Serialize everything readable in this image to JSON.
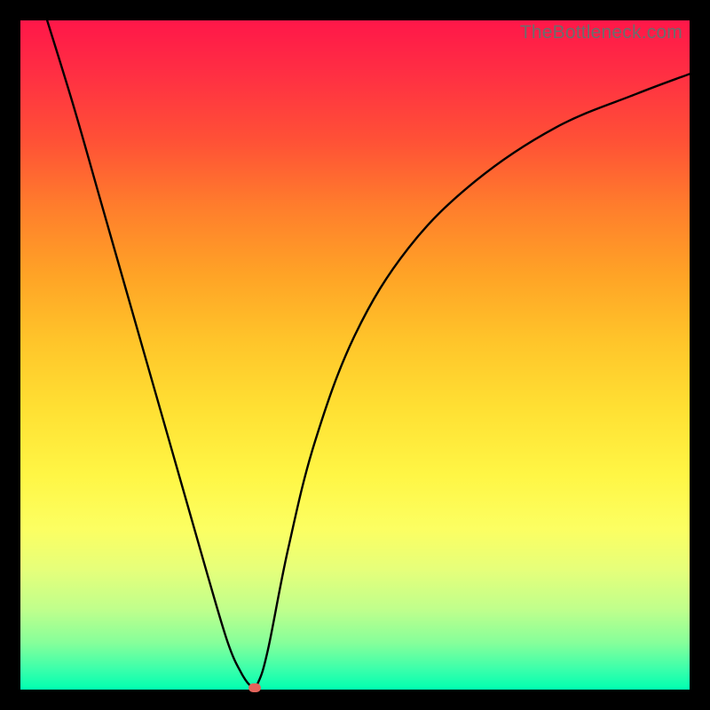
{
  "watermark": "TheBottleneck.com",
  "chart_data": {
    "type": "line",
    "title": "",
    "xlabel": "",
    "ylabel": "",
    "xlim": [
      0,
      100
    ],
    "ylim": [
      0,
      100
    ],
    "grid": false,
    "legend": false,
    "series": [
      {
        "name": "curve",
        "x": [
          4,
          8,
          12,
          16,
          20,
          24,
          28,
          31,
          33,
          34.5,
          35.5,
          37,
          40,
          44,
          50,
          58,
          68,
          80,
          92,
          100
        ],
        "y": [
          100,
          87,
          73,
          59,
          45,
          31,
          17,
          7,
          2.5,
          0.5,
          1,
          6,
          21,
          37,
          53,
          66,
          76,
          84,
          89,
          92
        ]
      }
    ],
    "marker": {
      "x": 35,
      "y": 0.3
    }
  },
  "colors": {
    "curve": "#000000",
    "marker": "#e2645b",
    "background_top": "#ff1749",
    "background_bottom": "#00ffb0"
  }
}
